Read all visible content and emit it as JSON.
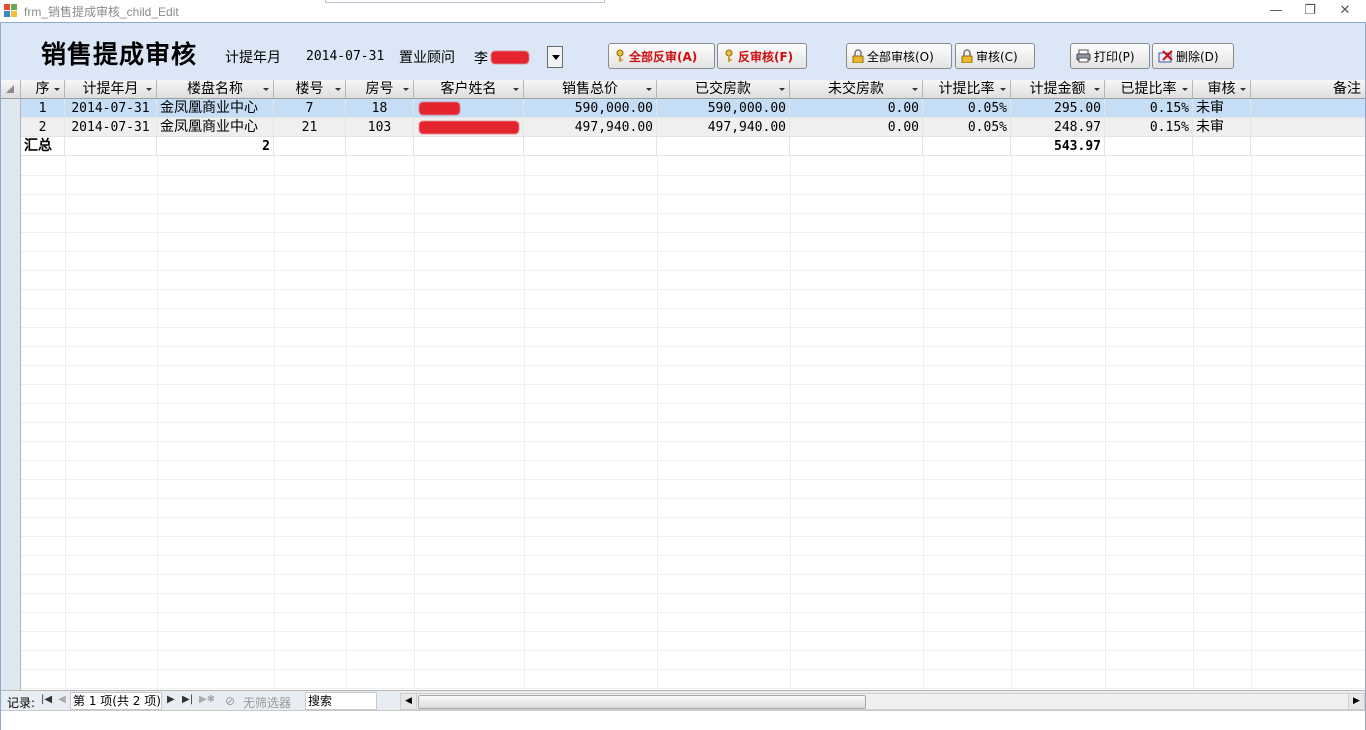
{
  "window": {
    "title": "frm_销售提成审核_child_Edit",
    "controls": [
      "—",
      "❐",
      "✕"
    ]
  },
  "header": {
    "form_title": "销售提成审核",
    "period_label": "计提年月",
    "period_value": "2014-07-31",
    "advisor_label": "置业顾问",
    "advisor_value": "李"
  },
  "toolbar": {
    "unaudit_all": "全部反审(A)",
    "unaudit": "反审核(F)",
    "audit_all": "全部审核(O)",
    "audit": "审核(C)",
    "print": "打印(P)",
    "delete": "删除(D)"
  },
  "table": {
    "columns": [
      "序",
      "计提年月",
      "楼盘名称",
      "楼号",
      "房号",
      "客户姓名",
      "销售总价",
      "已交房款",
      "未交房款",
      "计提比率",
      "计提金额",
      "已提比率",
      "审核",
      "备注"
    ],
    "rows": [
      {
        "seq": "1",
        "period": "2014-07-31",
        "project": "金凤凰商业中心",
        "building": "7",
        "room": "18",
        "customer": "",
        "total": "590,000.00",
        "paid": "590,000.00",
        "unpaid": "0.00",
        "rate": "0.05%",
        "amount": "295.00",
        "paid_rate": "0.15%",
        "audit": "未审",
        "note": ""
      },
      {
        "seq": "2",
        "period": "2014-07-31",
        "project": "金凤凰商业中心",
        "building": "21",
        "room": "103",
        "customer": "",
        "total": "497,940.00",
        "paid": "497,940.00",
        "unpaid": "0.00",
        "rate": "0.05%",
        "amount": "248.97",
        "paid_rate": "0.15%",
        "audit": "未审",
        "note": ""
      }
    ],
    "summary": {
      "label": "汇总",
      "count": "2",
      "amount_total": "543.97"
    }
  },
  "statusbar": {
    "record_label": "记录:",
    "position": "第 1 项(共 2 项)",
    "filter": "无筛选器",
    "search": "搜索"
  },
  "colors": {
    "selected_row": "#c6ddf6",
    "redaction": "#e4252f",
    "accent_red": "#d01010"
  }
}
